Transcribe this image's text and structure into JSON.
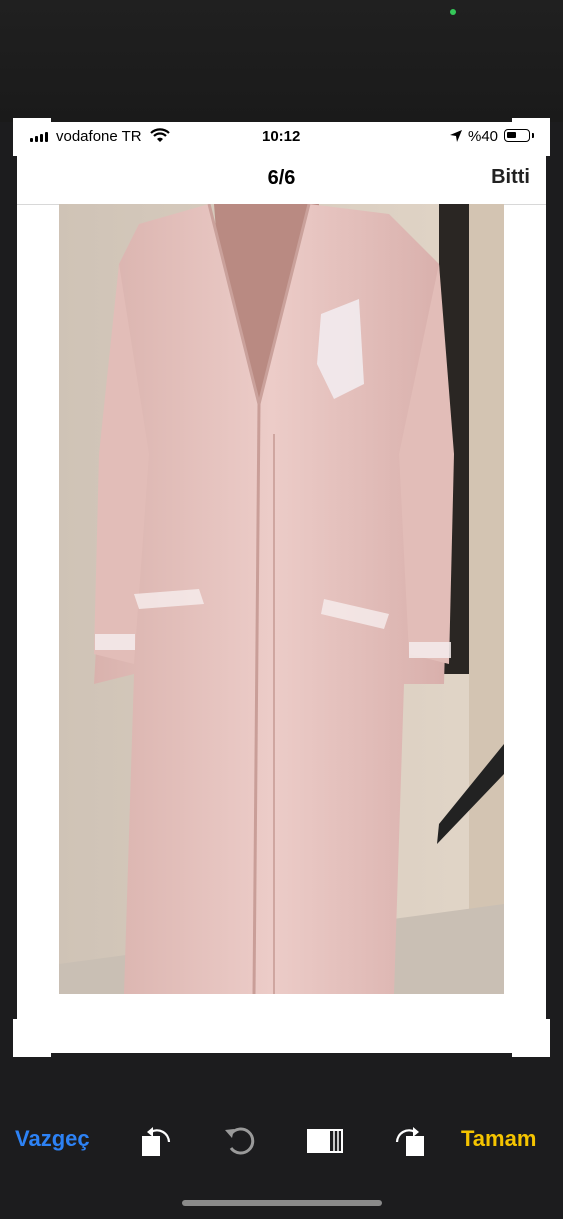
{
  "status_bar": {
    "carrier": "vodafone TR",
    "time": "10:12",
    "battery_percent": "%40",
    "icons": [
      "signal-icon",
      "wifi-icon",
      "location-arrow-icon",
      "battery-icon"
    ]
  },
  "viewer": {
    "counter": "6/6",
    "done_label": "Bitti"
  },
  "photo": {
    "subject_icon": "pink-robe-photo",
    "share_icon": "share-icon"
  },
  "toolbar": {
    "cancel_label": "Vazgeç",
    "ok_label": "Tamam",
    "tools": [
      "rotate-left-icon",
      "reset-rotation-icon",
      "aspect-ratio-icon",
      "rotate-right-icon"
    ]
  },
  "colors": {
    "cancel": "#2d82f5",
    "ok": "#f5c400",
    "robe": "#e8c6c4"
  }
}
